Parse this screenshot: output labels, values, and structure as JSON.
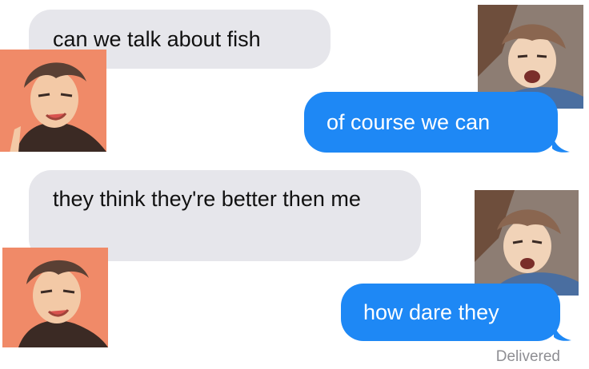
{
  "conversation": {
    "messages": [
      {
        "direction": "incoming",
        "text": "can we talk about fish"
      },
      {
        "direction": "outgoing",
        "text": "of course we can"
      },
      {
        "direction": "incoming",
        "text": "they think they're better then me"
      },
      {
        "direction": "outgoing",
        "text": "how dare they"
      }
    ],
    "status": "Delivered"
  },
  "colors": {
    "incoming_bubble": "#e6e6eb",
    "outgoing_bubble": "#1e88f5",
    "left_avatar_bg": "#f08a68",
    "right_avatar_bg": "#8d7d73"
  },
  "icons": {
    "left_avatar": "anime-character-avatar-icon",
    "right_avatar": "anime-character-avatar-icon"
  }
}
